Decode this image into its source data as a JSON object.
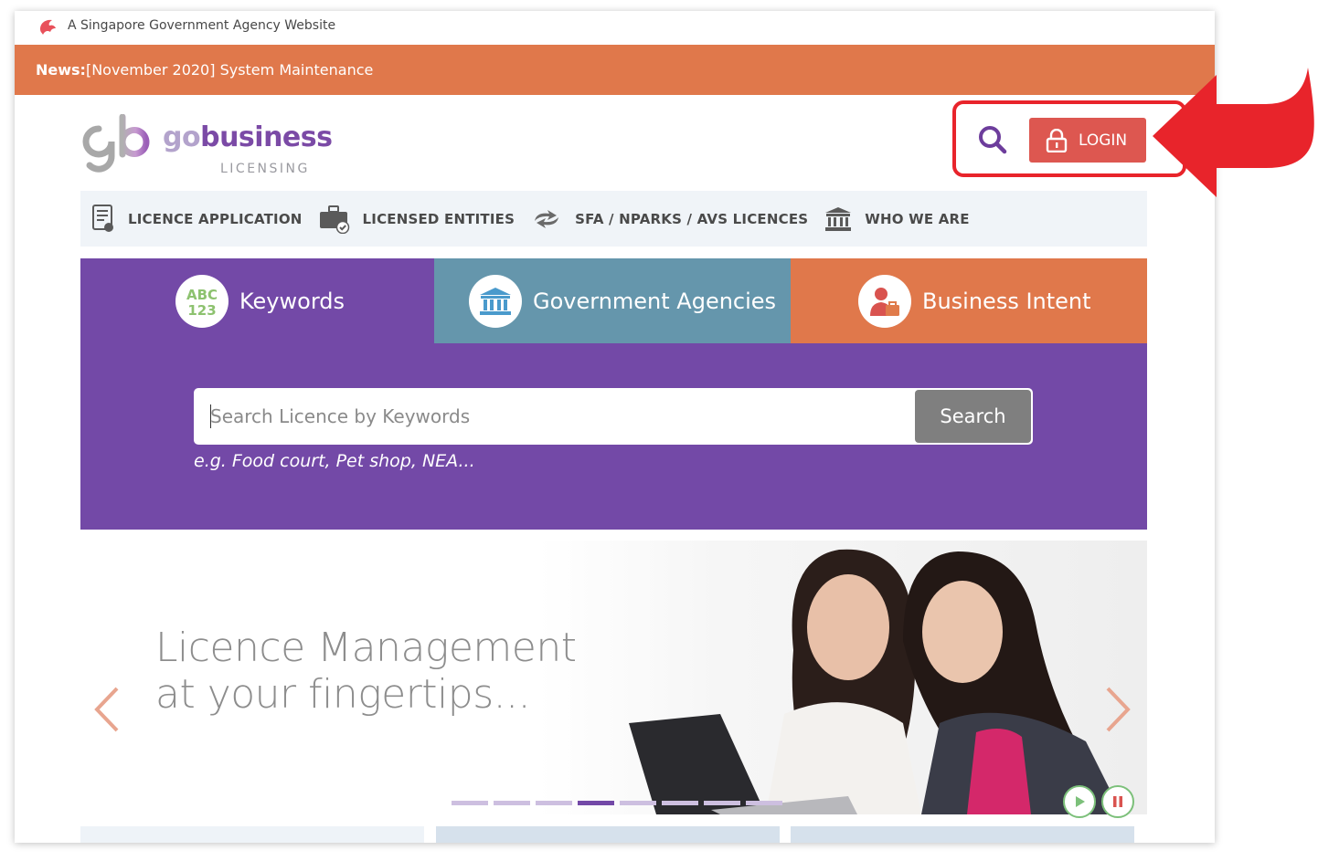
{
  "gov_bar": {
    "text": "A Singapore Government Agency Website"
  },
  "news": {
    "prefix": "News:",
    "text": "[November 2020] System Maintenance"
  },
  "logo": {
    "go": "go",
    "business": "business",
    "licensing": "LICENSING"
  },
  "header": {
    "login_label": "LOGIN"
  },
  "nav": {
    "items": [
      {
        "label": "LICENCE APPLICATION",
        "icon": "certificate-icon"
      },
      {
        "label": "LICENSED ENTITIES",
        "icon": "briefcase-check-icon"
      },
      {
        "label": "SFA / NPARKS / AVS LICENCES",
        "icon": "transfer-arrows-icon"
      },
      {
        "label": "WHO WE ARE",
        "icon": "government-building-icon"
      }
    ]
  },
  "tabs": [
    {
      "label": "Keywords",
      "icon": "abc-123-icon",
      "color": "#7349a7"
    },
    {
      "label": "Government Agencies",
      "icon": "building-icon",
      "color": "#6596ac"
    },
    {
      "label": "Business Intent",
      "icon": "person-briefcase-icon",
      "color": "#e0784b"
    }
  ],
  "search": {
    "placeholder": "Search Licence by Keywords",
    "button_label": "Search",
    "hint": "e.g. Food court, Pet shop, NEA..."
  },
  "hero": {
    "line1": "Licence Management",
    "line2": "at your fingertips...",
    "slides_total": 8,
    "active_slide": 4
  },
  "colors": {
    "news_bar": "#e0784b",
    "login_button": "#dd5750",
    "purple": "#7349a7",
    "annotation_red": "#e8242b"
  }
}
